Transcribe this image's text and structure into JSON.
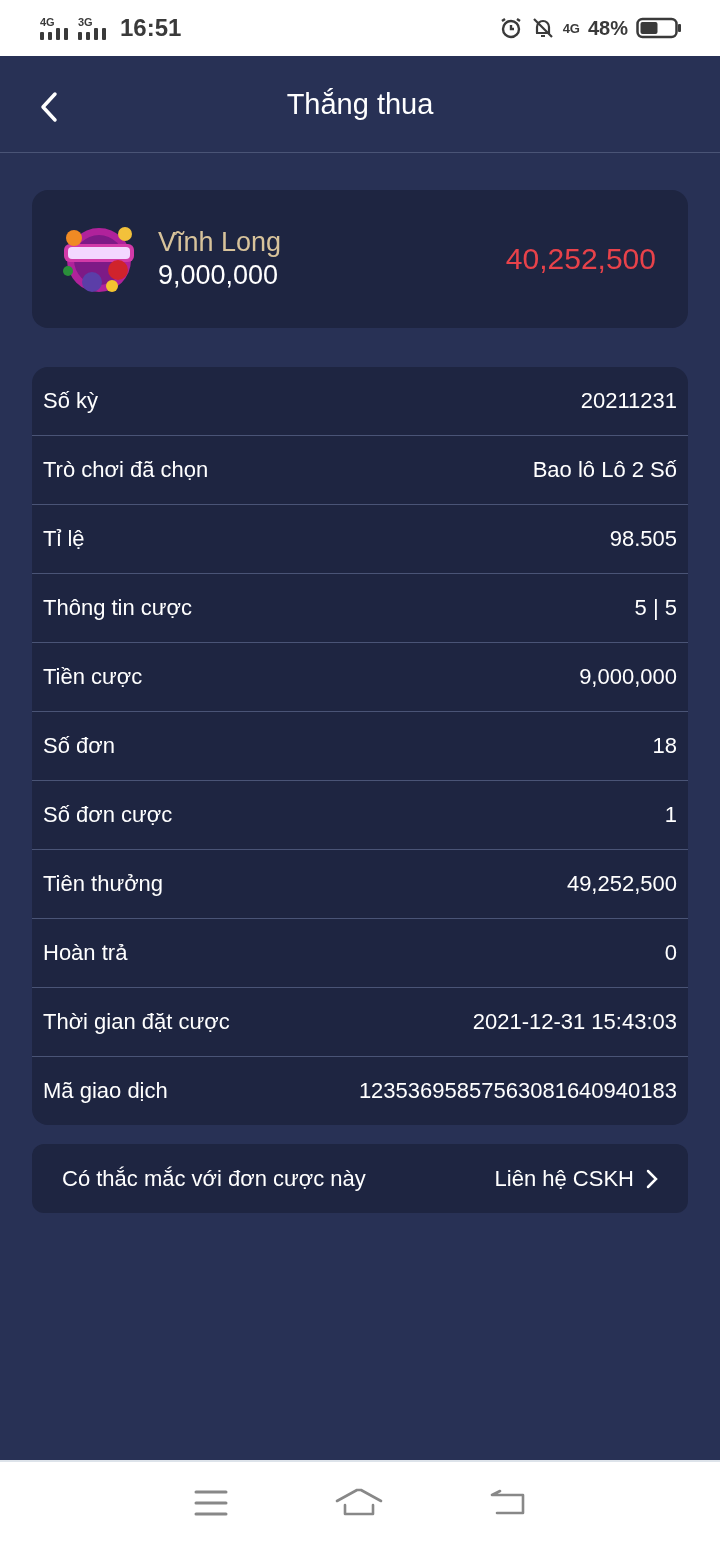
{
  "status_bar": {
    "network_1": "4G",
    "network_2": "3G",
    "time": "16:51",
    "data_type": "4G",
    "battery": "48%"
  },
  "header": {
    "title": "Thắng thua"
  },
  "summary": {
    "name": "Vĩnh Long",
    "stake": "9,000,000",
    "result": "40,252,500"
  },
  "details": [
    {
      "label": "Số kỳ",
      "value": "20211231"
    },
    {
      "label": "Trò chơi đã chọn",
      "value": "Bao lô Lô 2 Số"
    },
    {
      "label": "Tỉ lệ",
      "value": "98.505"
    },
    {
      "label": "Thông tin cược",
      "value": "5 | 5"
    },
    {
      "label": "Tiền cược",
      "value": "9,000,000"
    },
    {
      "label": "Số đơn",
      "value": "18"
    },
    {
      "label": "Số đơn cược",
      "value": "1"
    },
    {
      "label": "Tiên thưởng",
      "value": "49,252,500"
    },
    {
      "label": "Hoàn trả",
      "value": "0"
    },
    {
      "label": "Thời gian đặt cược",
      "value": "2021-12-31 15:43:03"
    },
    {
      "label": "Mã giao dịch",
      "value": "12353695857563081640940183"
    }
  ],
  "support": {
    "question": "Có thắc mắc với đơn cược này",
    "link": "Liên hệ CSKH"
  }
}
